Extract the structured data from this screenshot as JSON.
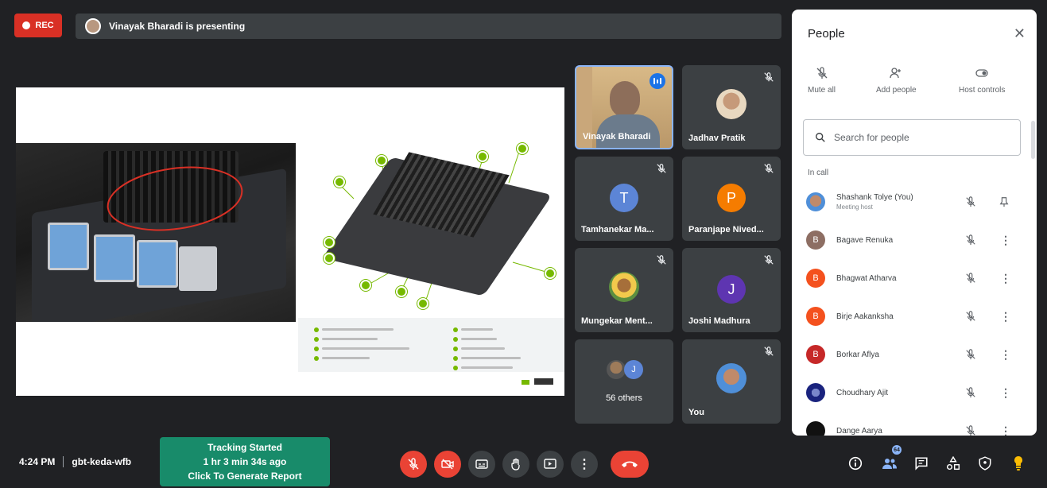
{
  "recording": {
    "label": "REC"
  },
  "presenter_banner": {
    "text": "Vinayak Bharadi is presenting"
  },
  "tiles": [
    {
      "name": "Vinayak Bharadi",
      "kind": "video"
    },
    {
      "name": "Jadhav Pratik",
      "kind": "photo"
    },
    {
      "name": "Tamhanekar Ma...",
      "kind": "letter",
      "letter": "T",
      "color": "#5c85d6"
    },
    {
      "name": "Paranjape Nived...",
      "kind": "letter",
      "letter": "P",
      "color": "#f57c00"
    },
    {
      "name": "Mungekar Ment...",
      "kind": "photo"
    },
    {
      "name": "Joshi Madhura",
      "kind": "letter",
      "letter": "J",
      "color": "#5e35b1"
    },
    {
      "name": "56 others",
      "kind": "others",
      "letter": "J"
    },
    {
      "name": "You",
      "kind": "photo"
    }
  ],
  "people_panel": {
    "title": "People",
    "controls": {
      "mute_all": "Mute all",
      "add_people": "Add people",
      "host_controls": "Host controls"
    },
    "search_placeholder": "Search for people",
    "section_label": "In call",
    "participants": [
      {
        "name": "Shashank Tolye (You)",
        "sub": "Meeting host",
        "letter": "",
        "color": "#8d6e63"
      },
      {
        "name": "Bagave Renuka",
        "letter": "B",
        "color": "#8d6e63"
      },
      {
        "name": "Bhagwat Atharva",
        "letter": "B",
        "color": "#f4511e"
      },
      {
        "name": "Birje Aakanksha",
        "letter": "B",
        "color": "#f4511e"
      },
      {
        "name": "Borkar Aflya",
        "letter": "B",
        "color": "#c62828"
      },
      {
        "name": "Choudhary Ajit",
        "letter": "",
        "color": "#283593"
      },
      {
        "name": "Dange Aarya",
        "letter": "",
        "color": "#111111"
      }
    ]
  },
  "bottom": {
    "time": "4:24 PM",
    "meeting_code": "gbt-keda-wfb",
    "tracking": {
      "line1": "Tracking Started",
      "line2": "1 hr 3 min 34s ago",
      "line3": "Click To Generate Report"
    },
    "participants_badge": "64"
  },
  "colors": {
    "rec": "#d93025",
    "end_call": "#ea4335",
    "tracking": "#188b6a",
    "accent": "#1a73e8"
  }
}
